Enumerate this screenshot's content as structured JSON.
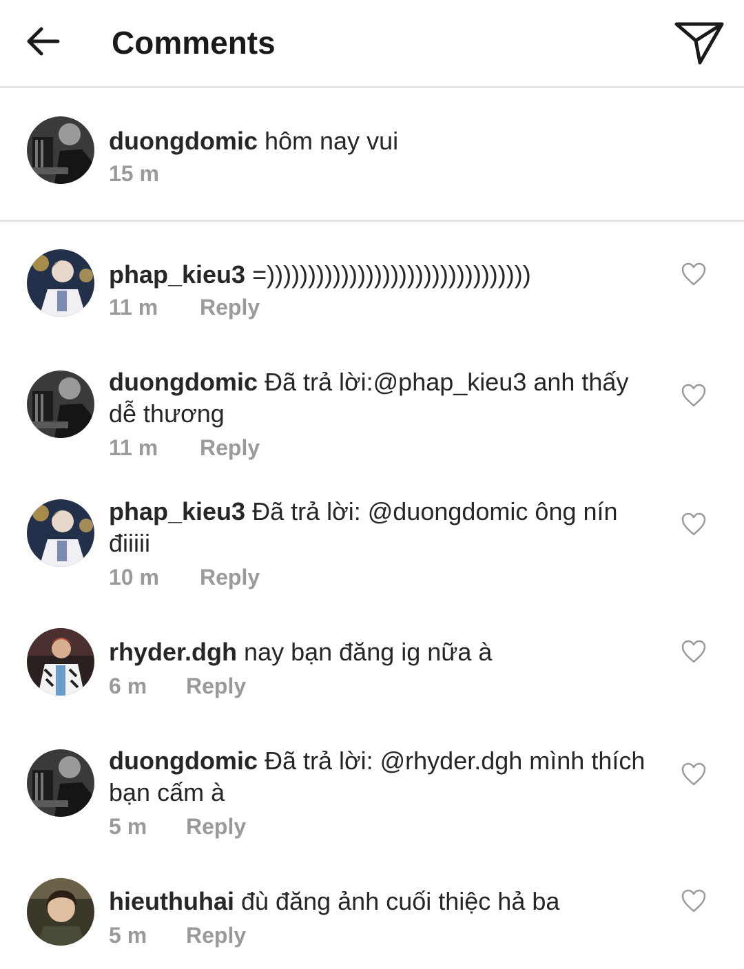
{
  "header": {
    "title": "Comments",
    "back_icon": "arrow-left-icon",
    "send_icon": "paper-plane-icon"
  },
  "caption": {
    "username": "duongdomic",
    "text": "hôm nay vui",
    "time": "15 m"
  },
  "comments": [
    {
      "username": "phap_kieu3",
      "text": "=))))))))))))))))))))))))))))))))",
      "time": "11 m",
      "reply_label": "Reply",
      "avatar": "phap_kieu3"
    },
    {
      "username": "duongdomic",
      "text": "Đã trả lời:@phap_kieu3 anh thấy dễ thương",
      "time": "11 m",
      "reply_label": "Reply",
      "avatar": "duongdomic"
    },
    {
      "username": "phap_kieu3",
      "text": "Đã trả lời: @duongdomic ông nín điiiii",
      "time": "10 m",
      "reply_label": "Reply",
      "avatar": "phap_kieu3"
    },
    {
      "username": "rhyder.dgh",
      "text": "nay bạn đăng ig nữa à",
      "time": "6 m",
      "reply_label": "Reply",
      "avatar": "rhyder.dgh"
    },
    {
      "username": "duongdomic",
      "text": "Đã trả lời: @rhyder.dgh mình thích bạn cấm à",
      "time": "5 m",
      "reply_label": "Reply",
      "avatar": "duongdomic"
    },
    {
      "username": "hieuthuhai",
      "text": "đù đăng ảnh cuối thiệc hả ba",
      "time": "5 m",
      "reply_label": "Reply",
      "avatar": "hieuthuhai"
    }
  ]
}
